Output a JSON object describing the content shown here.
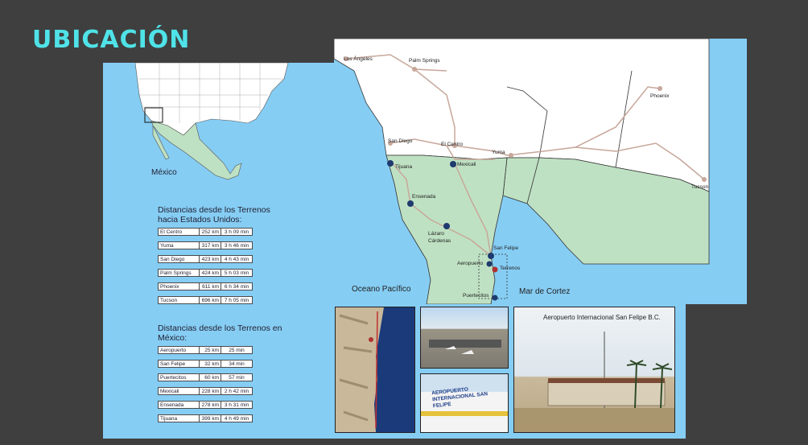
{
  "slide": {
    "title": "UBICACIÓN"
  },
  "overview_map": {
    "country_label": "México"
  },
  "us_distances": {
    "heading": "Distancias desde los Terrenos hacia Estados Unidos:",
    "rows": [
      {
        "place": "El Centro",
        "km": "252 km",
        "time": "3 h 09 min"
      },
      {
        "place": "Yuma",
        "km": "317 km",
        "time": "3 h 46 min"
      },
      {
        "place": "San Diego",
        "km": "423 km",
        "time": "4 h 43 min"
      },
      {
        "place": "Palm Springs",
        "km": "424 km",
        "time": "5 h 03 min"
      },
      {
        "place": "Phoenix",
        "km": "611 km",
        "time": "6 h 34 min"
      },
      {
        "place": "Tucson",
        "km": "696 km",
        "time": "7 h 05 min"
      }
    ]
  },
  "mx_distances": {
    "heading": "Distancias desde los Terrenos en México:",
    "rows": [
      {
        "place": "Aeropuerto",
        "km": "25 km",
        "time": "25 min"
      },
      {
        "place": "San Felipe",
        "km": "32 km",
        "time": "34 min"
      },
      {
        "place": "Puertecitos",
        "km": "60 km",
        "time": "57 min"
      },
      {
        "place": "Mexicali",
        "km": "228 km",
        "time": "2 h 42 min"
      },
      {
        "place": "Ensenada",
        "km": "278 km",
        "time": "3 h 31 min"
      },
      {
        "place": "Tijuana",
        "km": "399 km",
        "time": "4 h 49 min"
      }
    ]
  },
  "region_map": {
    "cities": {
      "los_angeles": "Los Ángeles",
      "palm_springs": "Palm Springs",
      "phoenix": "Phoenix",
      "san_diego": "San Diego",
      "el_centro": "El Centro",
      "yuma": "Yuma",
      "tucson": "Tucson",
      "tijuana": "Tijuana",
      "mexicali": "Mexicali",
      "ensenada": "Ensenada",
      "lazaro_cardenas": "Lázaro Cárdenas",
      "san_felipe": "San Felipe",
      "aeropuerto": "Aeropuerto",
      "terrenos": "Terrenos",
      "puertecitos": "Puertecitos"
    },
    "ocean_pacific": "Oceano Pacífico",
    "sea_cortez": "Mar de Cortez"
  },
  "photos": {
    "airport_title": "Aeropuerto Internacional San Felipe B.C.",
    "sign_text": "AEROPUERTO INTERNACIONAL SAN FELIPE"
  },
  "colors": {
    "accent": "#4fe3e8",
    "water": "#86cdf4",
    "mexico": "#bfe1c3",
    "us": "#ffffff",
    "road": "#c7a79a"
  }
}
